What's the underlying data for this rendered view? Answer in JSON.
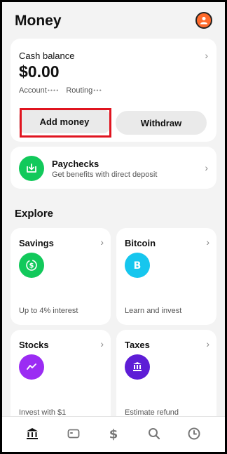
{
  "header": {
    "title": "Money",
    "avatar_icon": "profile-icon"
  },
  "balance": {
    "label": "Cash balance",
    "value": "$0.00",
    "account_label": "Account",
    "account_dots": "••••",
    "routing_label": "Routing",
    "routing_dots": "•••",
    "add_money_label": "Add money",
    "withdraw_label": "Withdraw"
  },
  "paychecks": {
    "title": "Paychecks",
    "subtitle": "Get benefits with direct deposit",
    "icon": "deposit-icon",
    "icon_color": "#12c95b"
  },
  "explore": {
    "title": "Explore",
    "tiles": [
      {
        "title": "Savings",
        "subtitle": "Up to 4% interest",
        "icon": "savings-icon",
        "color": "#12c95b"
      },
      {
        "title": "Bitcoin",
        "subtitle": "Learn and invest",
        "icon": "bitcoin-icon",
        "color": "#16c6ee"
      },
      {
        "title": "Stocks",
        "subtitle": "Invest with $1",
        "icon": "stocks-icon",
        "color": "#9b2cf3"
      },
      {
        "title": "Taxes",
        "subtitle": "Estimate refund",
        "icon": "taxes-icon",
        "color": "#5e1dd6"
      }
    ]
  },
  "tabbar": {
    "items": [
      "money-tab-icon",
      "card-tab-icon",
      "cash-tab-icon",
      "search-tab-icon",
      "activity-tab-icon"
    ]
  },
  "colors": {
    "highlight": "#e0141f",
    "accent": "#ff6a2b"
  }
}
